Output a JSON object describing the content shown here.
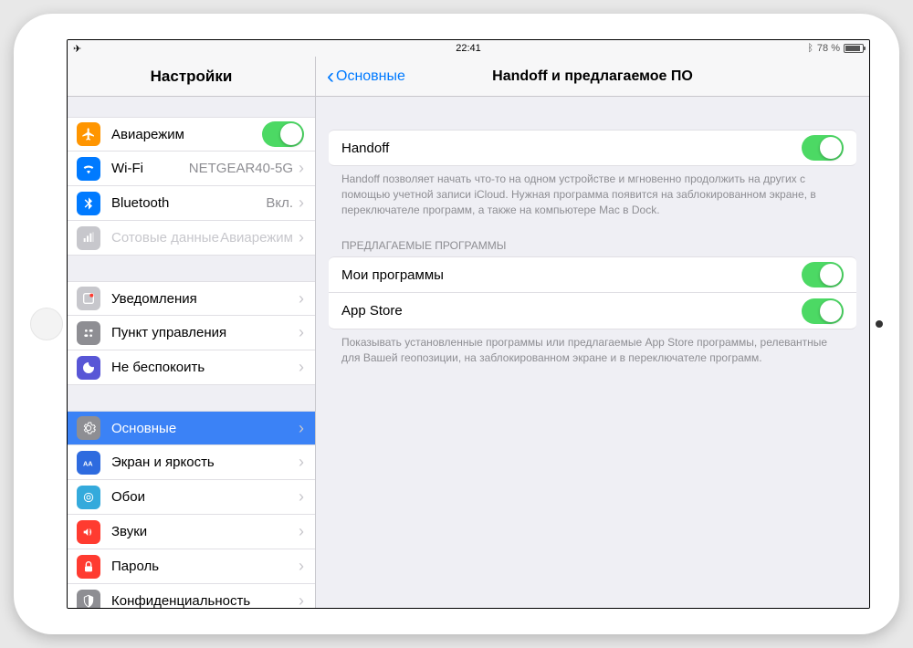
{
  "statusbar": {
    "time": "22:41",
    "battery_text": "78 %"
  },
  "sidebar": {
    "title": "Настройки",
    "groups": [
      [
        {
          "icon": "airplane",
          "bg": "bg-orange",
          "label": "Авиарежим",
          "toggle": true
        },
        {
          "icon": "wifi",
          "bg": "bg-blue",
          "label": "Wi-Fi",
          "value": "NETGEAR40-5G",
          "chev": true
        },
        {
          "icon": "bt",
          "bg": "bg-blue",
          "label": "Bluetooth",
          "value": "Вкл.",
          "chev": true
        },
        {
          "icon": "cell",
          "bg": "bg-green-d",
          "label": "Сотовые данные",
          "value": "Авиарежим",
          "chev": true,
          "disabled": true
        }
      ],
      [
        {
          "icon": "notif",
          "bg": "bg-lgray",
          "label": "Уведомления",
          "chev": true
        },
        {
          "icon": "cc",
          "bg": "bg-gray",
          "label": "Пункт управления",
          "chev": true
        },
        {
          "icon": "dnd",
          "bg": "bg-purple",
          "label": "Не беспокоить",
          "chev": true
        }
      ],
      [
        {
          "icon": "gear",
          "bg": "bg-gray",
          "label": "Основные",
          "chev": true,
          "selected": true
        },
        {
          "icon": "display",
          "bg": "bg-darkblue",
          "label": "Экран и яркость",
          "chev": true
        },
        {
          "icon": "wall",
          "bg": "bg-teal",
          "label": "Обои",
          "chev": true
        },
        {
          "icon": "sound",
          "bg": "bg-red",
          "label": "Звуки",
          "chev": true
        },
        {
          "icon": "lock",
          "bg": "bg-red",
          "label": "Пароль",
          "chev": true
        },
        {
          "icon": "privacy",
          "bg": "bg-gray",
          "label": "Конфиденциальность",
          "chev": true
        }
      ]
    ]
  },
  "detail": {
    "back": "Основные",
    "title": "Handoff и предлагаемое ПО",
    "sections": [
      {
        "rows": [
          {
            "label": "Handoff",
            "toggle": true
          }
        ],
        "footer": "Handoff позволяет начать что-то на одном устройстве и мгновенно продолжить на других с помощью учетной записи iCloud. Нужная программа появится на заблокированном экране, в переключателе программ, а также на компьютере Mac в Dock."
      },
      {
        "header": "ПРЕДЛАГАЕМЫЕ ПРОГРАММЫ",
        "rows": [
          {
            "label": "Мои программы",
            "toggle": true
          },
          {
            "label": "App Store",
            "toggle": true
          }
        ],
        "footer": "Показывать установленные программы или предлагаемые App Store программы, релевантные для Вашей геопозиции, на заблокированном экране и в переключателе программ."
      }
    ]
  }
}
